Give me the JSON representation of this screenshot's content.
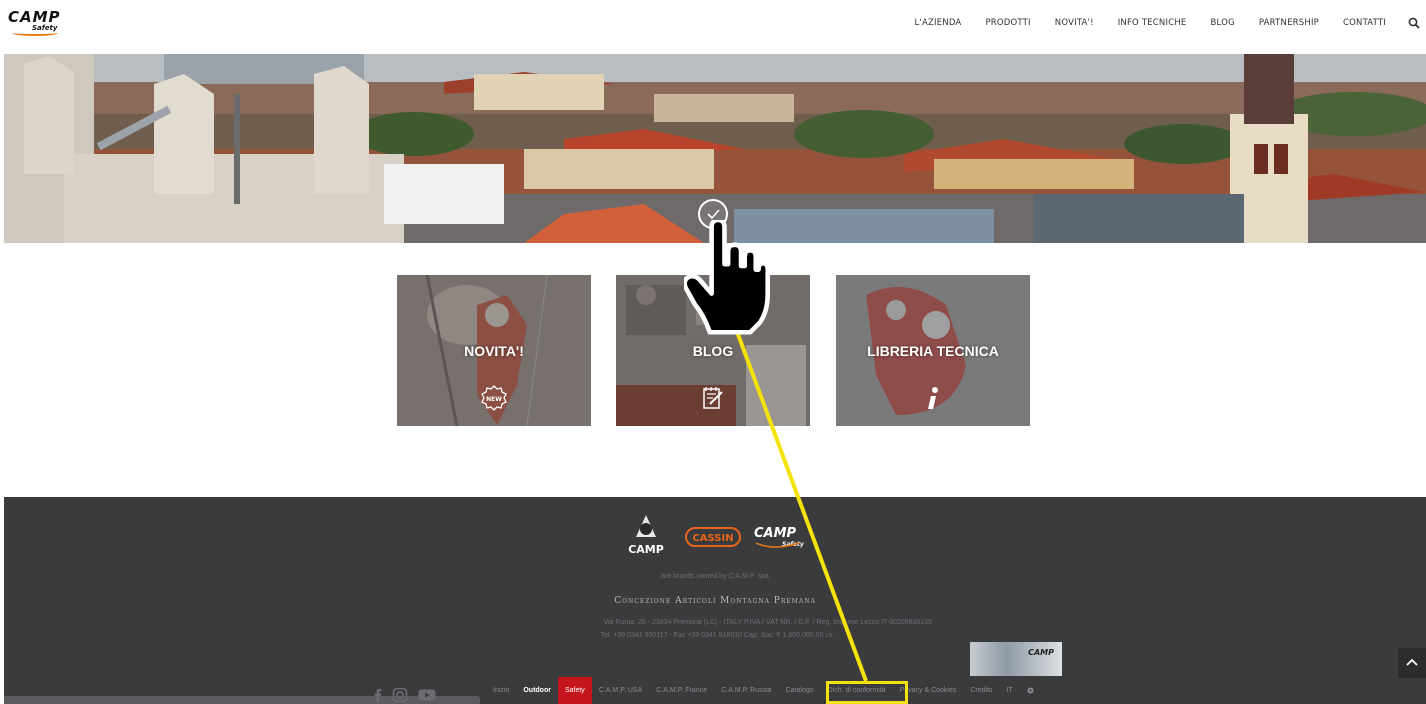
{
  "header": {
    "logo": {
      "word": "CAMP",
      "sub": "Safety"
    },
    "nav": [
      {
        "label": "L'AZIENDA"
      },
      {
        "label": "PRODOTTI"
      },
      {
        "label": "NOVITA'!"
      },
      {
        "label": "INFO TECNICHE"
      },
      {
        "label": "BLOG"
      },
      {
        "label": "PARTNERSHIP"
      },
      {
        "label": "CONTATTI"
      }
    ],
    "search_icon": "search-icon"
  },
  "hero": {
    "icon": "check-circle-icon"
  },
  "tiles": [
    {
      "label": "NOVITA'!",
      "icon": "new-badge-icon"
    },
    {
      "label": "BLOG",
      "icon": "notepad-pen-icon"
    },
    {
      "label": "LIBRERIA TECNICA",
      "icon": "info-icon"
    }
  ],
  "footer": {
    "brands": {
      "camp": "CAMP",
      "cassin": "CASSIN",
      "camp_safety": "CAMP",
      "camp_safety_sub": "Safety"
    },
    "brands_owned": "are brands owned by C.A.M.P. spa",
    "company_name": "Concezione Articoli Montagna Premana",
    "address_line1": "Via Roma, 25 - 23834 Premana (LC) - ITALY",
    "address_line2": "Tel. +39 0341 890117 - Fax +39 0341 818010",
    "vat_line1": "P.IVA / VAT NR. / C.F. / Reg. Imprese Lecco IT 00206830135",
    "vat_line2": "Cap. Soc. € 1.600.000,00 i.v.",
    "thumb_word": "CAMP",
    "links": [
      {
        "label": "Inizio",
        "style": "normal"
      },
      {
        "label": "Outdoor",
        "style": "bold"
      },
      {
        "label": "Safety",
        "style": "safety"
      },
      {
        "label": "C.A.M.P. USA",
        "style": "normal"
      },
      {
        "label": "C.A.M.P. France",
        "style": "normal"
      },
      {
        "label": "C.A.M.P. Russia",
        "style": "normal"
      },
      {
        "label": "Catalogo",
        "style": "normal"
      },
      {
        "label": "Dich. di conformità",
        "style": "normal"
      },
      {
        "label": "Privacy & Cookies",
        "style": "normal"
      },
      {
        "label": "Credits",
        "style": "normal"
      },
      {
        "label": "IT",
        "style": "normal"
      }
    ],
    "social": [
      "facebook-icon",
      "instagram-icon",
      "youtube-icon"
    ],
    "scroll_top_icon": "chevron-up-icon"
  },
  "colors": {
    "footer_bg": "#3a3b3d",
    "safety_red": "#c4161c",
    "annotation_yellow": "#f4e20a",
    "brand_orange": "#e87a12"
  }
}
